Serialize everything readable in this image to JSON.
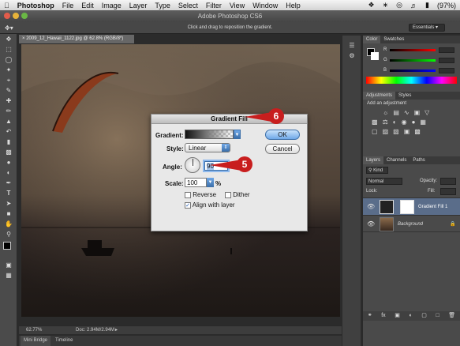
{
  "menubar": {
    "apple": "",
    "app": "Photoshop",
    "items": [
      "File",
      "Edit",
      "Image",
      "Layer",
      "Type",
      "Select",
      "Filter",
      "View",
      "Window",
      "Help"
    ],
    "status_battery": "(97%)"
  },
  "titlebar": {
    "title": "Adobe Photoshop CS6"
  },
  "options_bar": {
    "hint": "Click and drag to reposition the gradient.",
    "workspace": "Essentials"
  },
  "document": {
    "tab_label": "2009_12_Hawaii_1122.jpg @ 62.8% (RGB/8*)",
    "zoom": "62.77%",
    "doc_info": "Doc: 2.94M/2.94M"
  },
  "bottom_tabs": [
    "Mini Bridge",
    "Timeline"
  ],
  "panels": {
    "color_tabs": [
      "Color",
      "Swatches"
    ],
    "color_labels": [
      "R",
      "G",
      "B"
    ],
    "adjustment_tabs": [
      "Adjustments",
      "Styles"
    ],
    "adjustment_header": "Add an adjustment",
    "layers_tabs": [
      "Layers",
      "Channels",
      "Paths"
    ],
    "layer_kind": "Kind",
    "blend_mode": "Normal",
    "opacity_label": "Opacity:",
    "lock_label": "Lock:",
    "fill_label": "Fill:",
    "layers": [
      {
        "name": "Gradient Fill 1"
      },
      {
        "name": "Background"
      }
    ]
  },
  "dialog": {
    "title": "Gradient Fill",
    "gradient_label": "Gradient:",
    "style_label": "Style:",
    "style_value": "Linear",
    "angle_label": "Angle:",
    "angle_value": "90",
    "scale_label": "Scale:",
    "scale_value": "100",
    "scale_unit": "%",
    "reverse_label": "Reverse",
    "dither_label": "Dither",
    "align_label": "Align with layer",
    "ok_label": "OK",
    "cancel_label": "Cancel",
    "reverse_checked": false,
    "dither_checked": false,
    "align_checked": true
  },
  "callouts": {
    "step_ok": "6",
    "step_angle": "5"
  }
}
